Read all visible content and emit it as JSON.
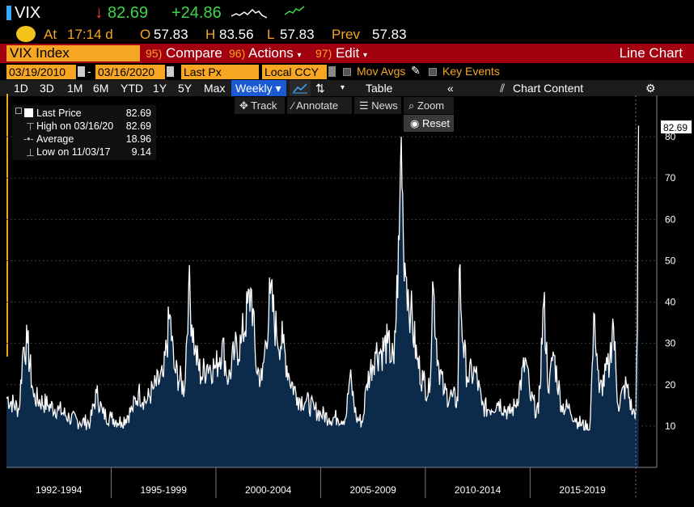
{
  "ticker": {
    "symbol": "VIX",
    "price": "82.69",
    "change": "+24.86"
  },
  "quote": {
    "at_label": "At",
    "time": "17:14 d",
    "open_label": "O",
    "open": "57.83",
    "high_label": "H",
    "high": "83.56",
    "low_label": "L",
    "low": "57.83",
    "prev_label": "Prev",
    "prev": "57.83"
  },
  "menu": {
    "index_name": "VIX Index",
    "compare": {
      "num": "95)",
      "label": "Compare"
    },
    "actions": {
      "num": "96)",
      "label": "Actions"
    },
    "edit": {
      "num": "97)",
      "label": "Edit"
    },
    "chart_type": "Line Chart"
  },
  "controls": {
    "start_date": "03/19/2010",
    "end_date": "03/16/2020",
    "price_field": "Last Px",
    "currency": "Local CCY",
    "mov_avgs": "Mov Avgs",
    "key_events": "Key Events"
  },
  "periods": [
    "1D",
    "3D",
    "1M",
    "6M",
    "YTD",
    "1Y",
    "5Y",
    "Max"
  ],
  "frequency": "Weekly",
  "table_label": "Table",
  "chart_content_label": "Chart Content",
  "tools": {
    "track": "Track",
    "annotate": "Annotate",
    "news": "News",
    "zoom": "Zoom",
    "reset": "Reset"
  },
  "legend": [
    {
      "label": "Last Price",
      "value": "82.69"
    },
    {
      "label": "High on 03/16/20",
      "value": "82.69"
    },
    {
      "label": "Average",
      "value": "18.96"
    },
    {
      "label": "Low on 11/03/17",
      "value": "9.14"
    }
  ],
  "colors": {
    "accent_orange": "#f6a623",
    "menu_red": "#a3000f",
    "up_green": "#3fd44a",
    "down_red": "#ff3b3b",
    "area_fill": "#0c2a4a"
  },
  "chart_data": {
    "type": "area",
    "series": [
      {
        "name": "VIX Index",
        "last_label": "82.69"
      }
    ],
    "x_ticks": [
      "1992-1994",
      "1995-1999",
      "2000-2004",
      "2005-2009",
      "2010-2014",
      "2015-2019"
    ],
    "y_ticks": [
      "10",
      "20",
      "30",
      "40",
      "50",
      "60",
      "70",
      "80"
    ],
    "ylim": [
      0,
      90
    ],
    "xlim": [
      1990.0,
      2020.2
    ],
    "points": [
      [
        1990.0,
        17
      ],
      [
        1990.6,
        14
      ],
      [
        1990.8,
        29
      ],
      [
        1991.0,
        30
      ],
      [
        1991.3,
        17
      ],
      [
        1992.0,
        15
      ],
      [
        1992.5,
        14
      ],
      [
        1993.0,
        12
      ],
      [
        1993.5,
        11
      ],
      [
        1994.0,
        11
      ],
      [
        1994.3,
        18
      ],
      [
        1994.6,
        13
      ],
      [
        1995.0,
        12
      ],
      [
        1995.5,
        11
      ],
      [
        1996.0,
        14
      ],
      [
        1996.3,
        18
      ],
      [
        1996.7,
        16
      ],
      [
        1997.0,
        19
      ],
      [
        1997.5,
        22
      ],
      [
        1997.8,
        37
      ],
      [
        1998.0,
        24
      ],
      [
        1998.5,
        19
      ],
      [
        1998.7,
        44
      ],
      [
        1999.0,
        28
      ],
      [
        1999.3,
        22
      ],
      [
        1999.6,
        25
      ],
      [
        2000.0,
        24
      ],
      [
        2000.3,
        30
      ],
      [
        2000.6,
        21
      ],
      [
        2000.9,
        28
      ],
      [
        2001.2,
        30
      ],
      [
        2001.7,
        43
      ],
      [
        2001.9,
        25
      ],
      [
        2002.2,
        21
      ],
      [
        2002.6,
        42
      ],
      [
        2002.9,
        32
      ],
      [
        2003.2,
        30
      ],
      [
        2003.5,
        22
      ],
      [
        2003.9,
        17
      ],
      [
        2004.3,
        16
      ],
      [
        2004.7,
        14
      ],
      [
        2005.0,
        13
      ],
      [
        2005.4,
        12
      ],
      [
        2005.8,
        12
      ],
      [
        2006.2,
        12
      ],
      [
        2006.4,
        22
      ],
      [
        2006.7,
        12
      ],
      [
        2007.0,
        11
      ],
      [
        2007.2,
        20
      ],
      [
        2007.6,
        28
      ],
      [
        2007.9,
        28
      ],
      [
        2008.2,
        30
      ],
      [
        2008.5,
        25
      ],
      [
        2008.75,
        55
      ],
      [
        2008.85,
        80
      ],
      [
        2008.95,
        55
      ],
      [
        2009.1,
        46
      ],
      [
        2009.3,
        38
      ],
      [
        2009.6,
        26
      ],
      [
        2009.9,
        21
      ],
      [
        2010.2,
        18
      ],
      [
        2010.35,
        45
      ],
      [
        2010.6,
        26
      ],
      [
        2010.9,
        18
      ],
      [
        2011.3,
        17
      ],
      [
        2011.55,
        16
      ],
      [
        2011.62,
        48
      ],
      [
        2011.8,
        30
      ],
      [
        2012.0,
        22
      ],
      [
        2012.4,
        23
      ],
      [
        2012.7,
        15
      ],
      [
        2013.0,
        14
      ],
      [
        2013.5,
        16
      ],
      [
        2014.0,
        13
      ],
      [
        2014.3,
        15
      ],
      [
        2014.8,
        26
      ],
      [
        2015.0,
        17
      ],
      [
        2015.4,
        13
      ],
      [
        2015.65,
        40
      ],
      [
        2015.9,
        18
      ],
      [
        2016.1,
        28
      ],
      [
        2016.5,
        15
      ],
      [
        2016.9,
        14
      ],
      [
        2017.3,
        11
      ],
      [
        2017.84,
        9.14
      ],
      [
        2018.08,
        37
      ],
      [
        2018.3,
        18
      ],
      [
        2018.8,
        25
      ],
      [
        2018.95,
        36
      ],
      [
        2019.2,
        15
      ],
      [
        2019.6,
        20
      ],
      [
        2019.9,
        13
      ],
      [
        2020.05,
        14
      ],
      [
        2020.12,
        33
      ],
      [
        2020.18,
        82.69
      ]
    ]
  }
}
